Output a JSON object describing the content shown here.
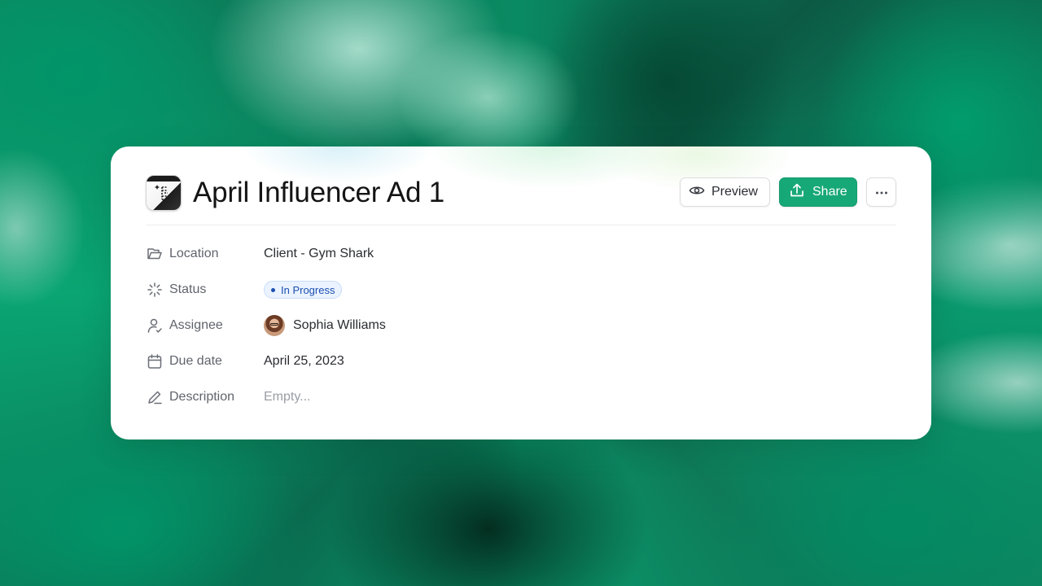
{
  "page": {
    "title": "April Influencer Ad 1"
  },
  "actions": {
    "preview_label": "Preview",
    "share_label": "Share",
    "more_icon": "ellipsis-icon"
  },
  "properties": [
    {
      "icon": "folder-icon",
      "label": "Location",
      "value": "Client - Gym Shark"
    },
    {
      "icon": "loader-icon",
      "label": "Status",
      "value": "In Progress"
    },
    {
      "icon": "user-check-icon",
      "label": "Assignee",
      "value": "Sophia Williams"
    },
    {
      "icon": "calendar-icon",
      "label": "Due date",
      "value": "April 25, 2023"
    },
    {
      "icon": "pen-icon",
      "label": "Description",
      "value": "Empty..."
    }
  ],
  "colors": {
    "accent": "#17a877",
    "status_badge_bg": "#eaf3ff",
    "status_badge_text": "#1c4fb0"
  }
}
